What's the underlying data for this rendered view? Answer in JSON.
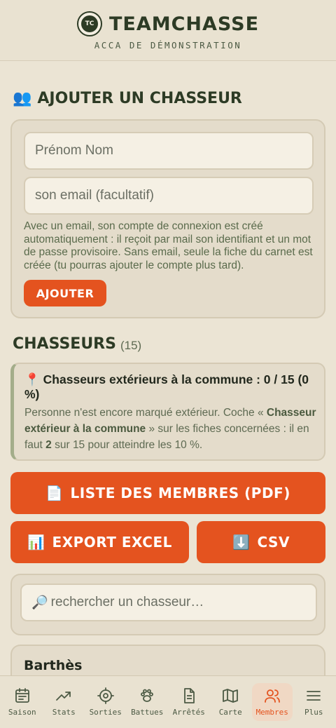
{
  "header": {
    "logo_text": "TC",
    "title": "TEAMCHASSE",
    "subtitle": "ACCA DE DÉMONSTRATION"
  },
  "add_section": {
    "icon": "👥",
    "title": "AJOUTER UN CHASSEUR",
    "name_placeholder": "Prénom Nom",
    "email_placeholder": "son email (facultatif)",
    "hint": "Avec un email, son compte de connexion est créé automatiquement : il reçoit par mail son identifiant et un mot de passe provisoire. Sans email, seule la fiche du carnet est créée (tu pourras ajouter le compte plus tard).",
    "add_button": "AJOUTER"
  },
  "hunters_section": {
    "title": "CHASSEURS",
    "count": "(15)",
    "info": {
      "icon": "📍",
      "title": "Chasseurs extérieurs à la commune : 0 / 15 (0 %)",
      "body_1": "Personne n'est encore marqué extérieur. Coche « ",
      "body_bold_1": "Chasseur extérieur à la commune",
      "body_2": " » sur les fiches concernées : il en faut ",
      "body_bold_2": "2",
      "body_3": " sur 15 pour atteindre les 10 %."
    },
    "pdf_button": {
      "icon": "📄",
      "label": "LISTE DES MEMBRES (PDF)"
    },
    "excel_button": {
      "icon": "📊",
      "label": "EXPORT EXCEL"
    },
    "csv_button": {
      "icon": "⬇️",
      "label": "CSV"
    },
    "search": {
      "icon": "🔎",
      "placeholder": "rechercher un chasseur…"
    },
    "first_hunter": "Barthès"
  },
  "nav": {
    "items": [
      {
        "label": "Saison",
        "icon": "calendar-icon"
      },
      {
        "label": "Stats",
        "icon": "trending-up-icon"
      },
      {
        "label": "Sorties",
        "icon": "target-icon"
      },
      {
        "label": "Battues",
        "icon": "paw-icon"
      },
      {
        "label": "Arrêtés",
        "icon": "document-icon"
      },
      {
        "label": "Carte",
        "icon": "map-icon"
      },
      {
        "label": "Membres",
        "icon": "users-icon",
        "active": true
      },
      {
        "label": "Plus",
        "icon": "menu-icon"
      }
    ],
    "active_color": "#e4531f"
  },
  "colors": {
    "accent": "#e4531f",
    "primary": "#2d3b25",
    "background": "#ebe4d4"
  }
}
